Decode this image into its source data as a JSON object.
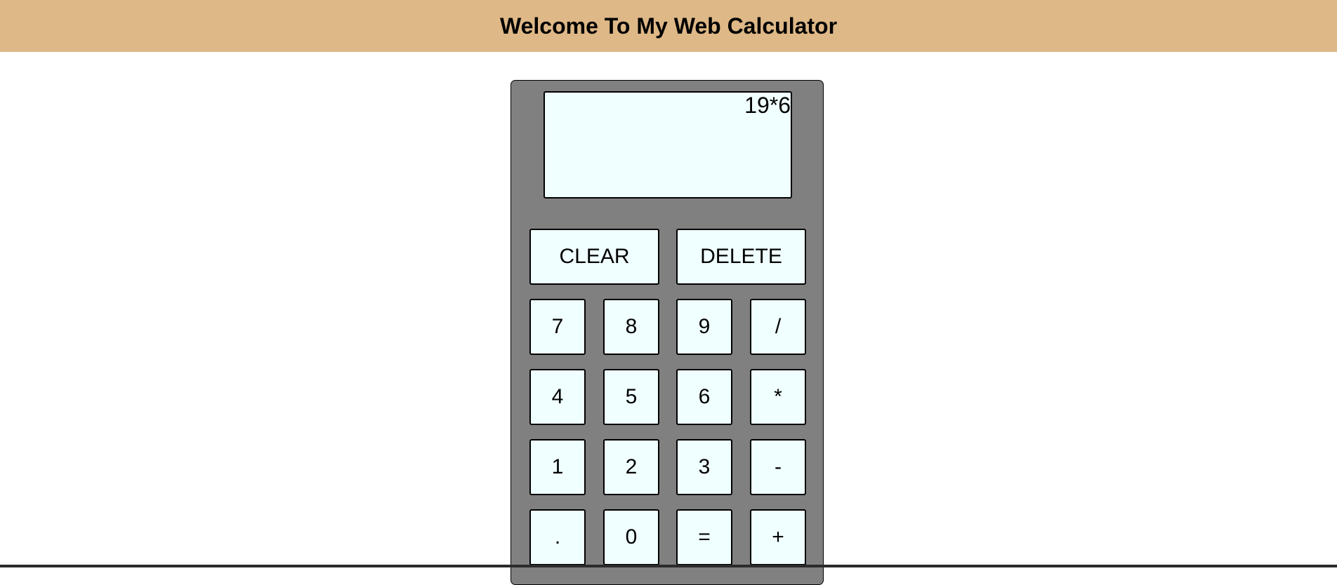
{
  "header": {
    "title": "Welcome To My Web Calculator"
  },
  "display": {
    "value": "19*6"
  },
  "buttons": {
    "clear": "CLEAR",
    "delete": "DELETE",
    "seven": "7",
    "eight": "8",
    "nine": "9",
    "divide": "/",
    "four": "4",
    "five": "5",
    "six": "6",
    "multiply": "*",
    "one": "1",
    "two": "2",
    "three": "3",
    "minus": "-",
    "dot": ".",
    "zero": "0",
    "equals": "=",
    "plus": "+"
  },
  "colors": {
    "header_bg": "#deb887",
    "calculator_bg": "#808080",
    "key_bg": "#f0ffff"
  }
}
